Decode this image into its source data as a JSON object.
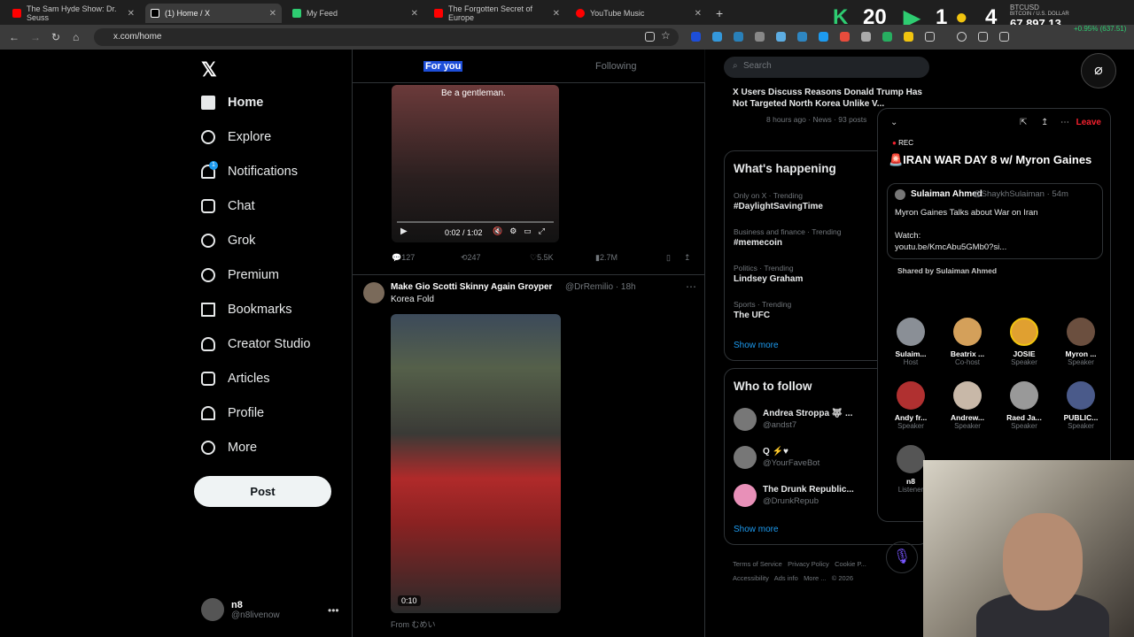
{
  "browser": {
    "tabs": [
      {
        "title": "The Sam Hyde Show: Dr. Seuss",
        "color": "#ff0000"
      },
      {
        "title": "(1) Home / X",
        "color": "#ffffff"
      },
      {
        "title": "My Feed",
        "color": "#2ecc71"
      },
      {
        "title": "The Forgotten Secret of Europe",
        "color": "#ff0000"
      },
      {
        "title": "YouTube Music",
        "color": "#ff0000"
      }
    ],
    "url": "x.com/home",
    "overlay": [
      "20",
      "1",
      "4"
    ],
    "ticker": {
      "symbol": "BTCUSD",
      "sub": "BITCOIN / U.S. DOLLAR",
      "price": "67,897.13",
      "change": "+0.95% (637.51)"
    }
  },
  "nav": {
    "items": [
      "Home",
      "Explore",
      "Notifications",
      "Chat",
      "Grok",
      "Premium",
      "Bookmarks",
      "Creator Studio",
      "Articles",
      "Profile",
      "More"
    ],
    "notif_badge": "1",
    "post_label": "Post",
    "me_name": "n8",
    "me_handle": "@n8livenow"
  },
  "feed": {
    "tab_foryou": "For you",
    "tab_following": "Following",
    "video_caption": "Be a gentleman.",
    "video_time": "0:02 / 1:02",
    "actions": {
      "replies": "127",
      "reposts": "247",
      "likes": "5.5K",
      "views": "2.7M"
    },
    "post2": {
      "name": "Make Gio Scotti Skinny Again Groyper",
      "handle": "@DrRemilio · 18h",
      "text": "Korea Fold",
      "duration": "0:10",
      "from": "From むめい"
    }
  },
  "sidebar": {
    "search_placeholder": "Search",
    "top_trend": {
      "title": "X Users Discuss Reasons Donald Trump Has Not Targeted North Korea Unlike V...",
      "meta": "8 hours ago · News · 93 posts"
    },
    "whats_happening": "What's happening",
    "trends": [
      {
        "cat": "Only on X · Trending",
        "name": "#DaylightSavingTime"
      },
      {
        "cat": "Business and finance · Trending",
        "name": "#memecoin"
      },
      {
        "cat": "Politics · Trending",
        "name": "Lindsey Graham"
      },
      {
        "cat": "Sports · Trending",
        "name": "The UFC"
      }
    ],
    "show_more": "Show more",
    "who_to_follow": "Who to follow",
    "follow": [
      {
        "name": "Andrea Stroppa 🐺 ...",
        "handle": "@andst7"
      },
      {
        "name": "Q ⚡♥",
        "handle": "@YourFaveBot"
      },
      {
        "name": "The Drunk Republic...",
        "handle": "@DrunkRepub"
      }
    ],
    "footer": [
      "Terms of Service",
      "Privacy Policy",
      "Cookie P...",
      "Accessibility",
      "Ads info",
      "More ...",
      "© 2026"
    ]
  },
  "space": {
    "leave": "Leave",
    "rec": "REC",
    "title": "🚨IRAN WAR DAY 8 w/ Myron Gaines",
    "card_name": "Sulaiman Ahmed",
    "card_handle": "@ShaykhSulaiman · 54m",
    "card_text": "Myron Gaines Talks about War on Iran",
    "card_watch": "Watch:",
    "card_link": "youtu.be/KmcAbu5GMb0?si...",
    "shared": "Shared by Sulaiman Ahmed",
    "participants": [
      {
        "name": "Sulaim...",
        "role": "Host"
      },
      {
        "name": "Beatrix ...",
        "role": "Co-host"
      },
      {
        "name": "JOSIE",
        "role": "Speaker"
      },
      {
        "name": "Myron ...",
        "role": "Speaker"
      },
      {
        "name": "Andy fr...",
        "role": "Speaker"
      },
      {
        "name": "Andrew...",
        "role": "Speaker"
      },
      {
        "name": "Raed Ja...",
        "role": "Speaker"
      },
      {
        "name": "PUBLIC...",
        "role": "Speaker"
      },
      {
        "name": "n8",
        "role": "Listener"
      }
    ]
  }
}
